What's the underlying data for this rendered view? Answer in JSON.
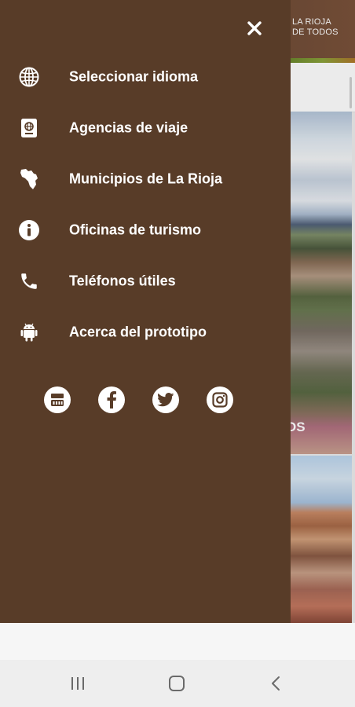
{
  "header": {
    "logo_line1": "LA RIOJA",
    "logo_line2": "DE TODOS"
  },
  "background": {
    "card1_title_partial": "OS"
  },
  "drawer": {
    "close_icon": "close-icon",
    "menu": [
      {
        "label": "Seleccionar idioma",
        "icon": "globe-icon"
      },
      {
        "label": "Agencias de viaje",
        "icon": "passport-icon"
      },
      {
        "label": "Municipios de La Rioja",
        "icon": "province-map-icon"
      },
      {
        "label": "Oficinas de turismo",
        "icon": "info-icon"
      },
      {
        "label": "Teléfonos útiles",
        "icon": "phone-icon"
      },
      {
        "label": "Acerca del prototipo",
        "icon": "android-icon"
      }
    ],
    "social": [
      "youtube-icon",
      "facebook-icon",
      "twitter-icon",
      "instagram-icon"
    ]
  },
  "colors": {
    "drawer_background": "#583c28",
    "drawer_text": "#ffffff",
    "nav_background": "#eeeeee"
  },
  "system_nav": {
    "buttons": [
      "recent-apps-icon",
      "home-icon",
      "back-icon"
    ]
  }
}
